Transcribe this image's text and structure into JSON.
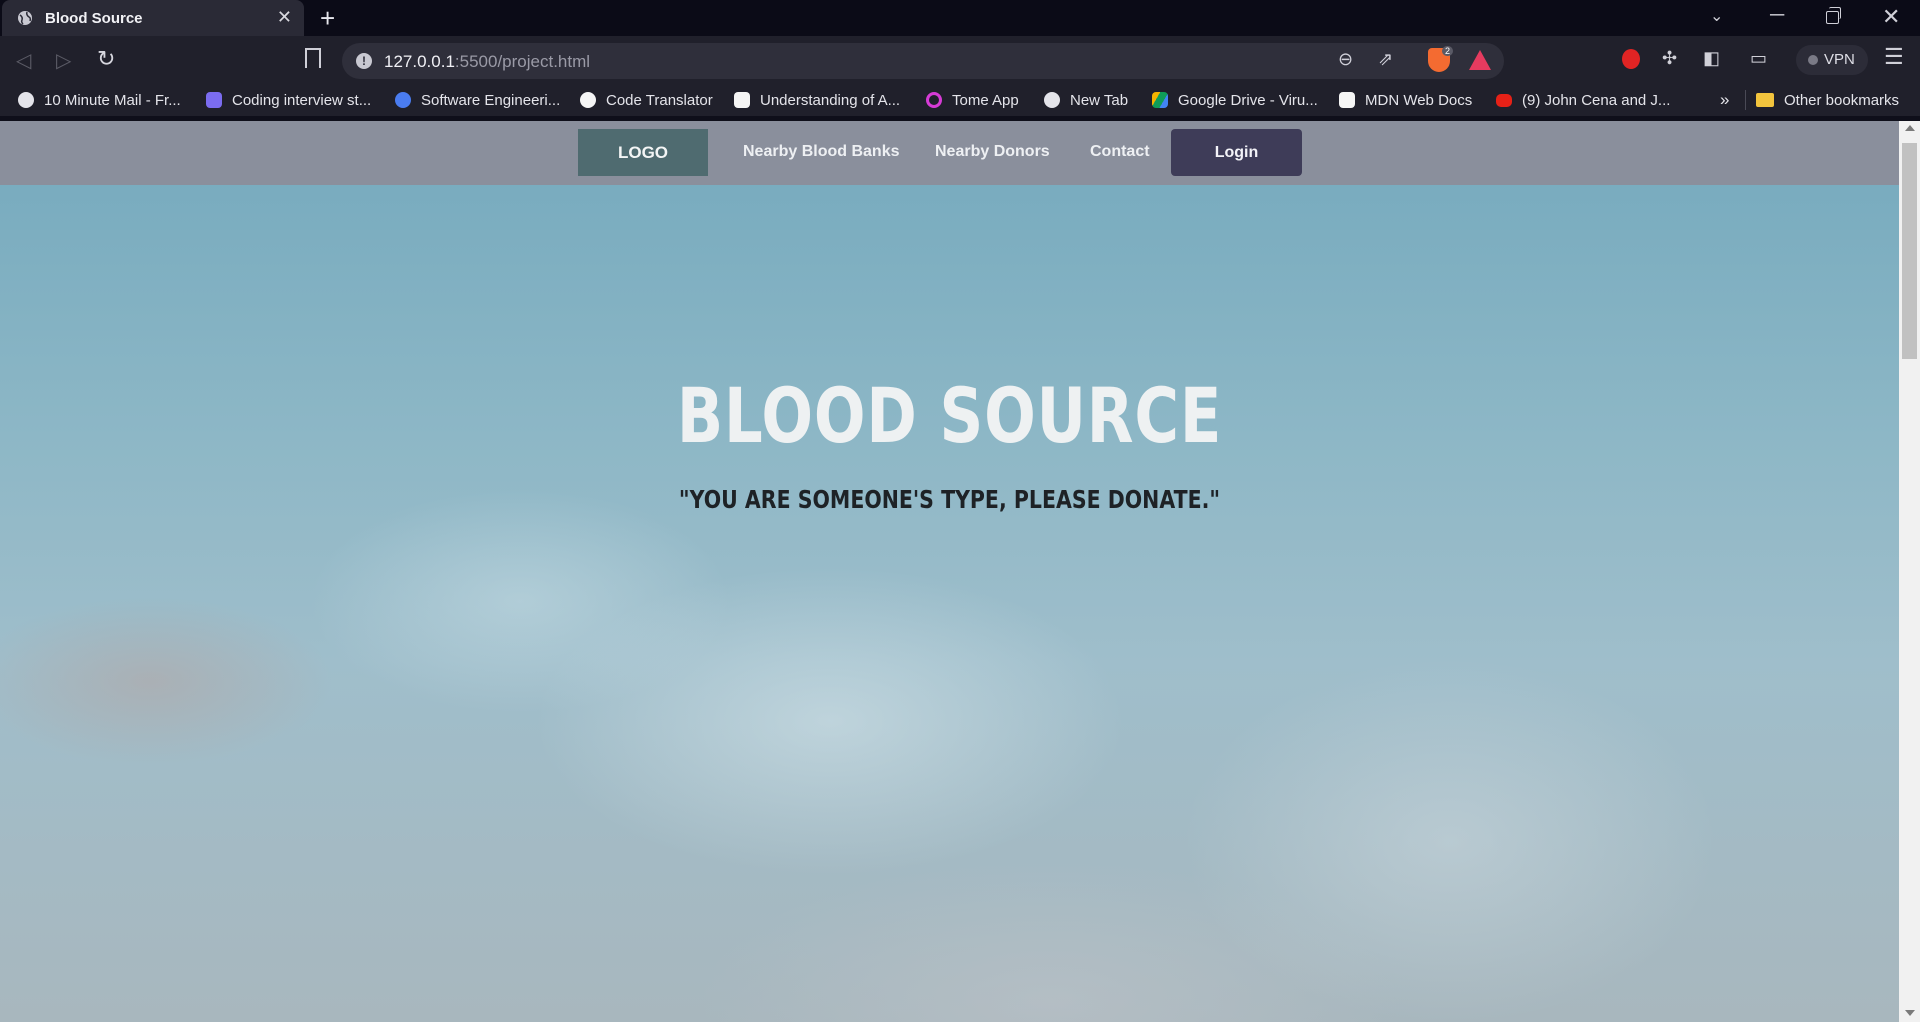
{
  "browser": {
    "tab": {
      "title": "Blood Source",
      "close": "✕",
      "icon": "globe-icon"
    },
    "new_tab": "+",
    "window_controls": {
      "minimize": "─",
      "close": "✕"
    },
    "toolbar": {
      "back": "◁",
      "forward": "▷",
      "reload": "↻",
      "url_host": "127.0.0.1",
      "url_path": ":5500/project.html",
      "info": "!",
      "brave_shields_count": "2",
      "vpn_label": "VPN",
      "menu": "☰"
    },
    "bookmarks": [
      {
        "label": "10 Minute Mail - Fr...",
        "icon_color": "#e4e4ea",
        "icon": "globe-icon"
      },
      {
        "label": "Coding interview st...",
        "icon_color": "#7b6cf0",
        "icon": "code-icon"
      },
      {
        "label": "Software Engineeri...",
        "icon_color": "#4a7cf0",
        "icon": "at-icon"
      },
      {
        "label": "Code Translator",
        "icon_color": "#f5f5f5",
        "icon": "triangle-icon"
      },
      {
        "label": "Understanding of A...",
        "icon_color": "#f5f5f5",
        "icon": "medium-icon"
      },
      {
        "label": "Tome App",
        "icon_color": "#d63bd6",
        "icon": "tome-icon"
      },
      {
        "label": "New Tab",
        "icon_color": "#e4e4ea",
        "icon": "globe-icon"
      },
      {
        "label": "Google Drive - Viru...",
        "icon_color": "#3c9c4a",
        "icon": "drive-icon"
      },
      {
        "label": "MDN Web Docs",
        "icon_color": "#f5f5f5",
        "icon": "mdn-icon"
      },
      {
        "label": "(9) John Cena and J...",
        "icon_color": "#e62117",
        "icon": "youtube-icon"
      }
    ],
    "bookmarks_more": "»",
    "other_bookmarks": "Other bookmarks"
  },
  "page": {
    "navbar": {
      "logo": "LOGO",
      "links": [
        "Nearby Blood Banks",
        "Nearby Donors",
        "Contact"
      ],
      "login": "Login"
    },
    "hero": {
      "title": "BLOOD SOURCE",
      "subtitle": "\"YOU ARE SOMEONE'S TYPE, PLEASE DONATE.\""
    }
  },
  "colors": {
    "navbar_bg": "#8a8f9c",
    "logo_bg": "#4f6b70",
    "login_bg": "#3e3c58",
    "hero_tint": "#8db7c6"
  }
}
